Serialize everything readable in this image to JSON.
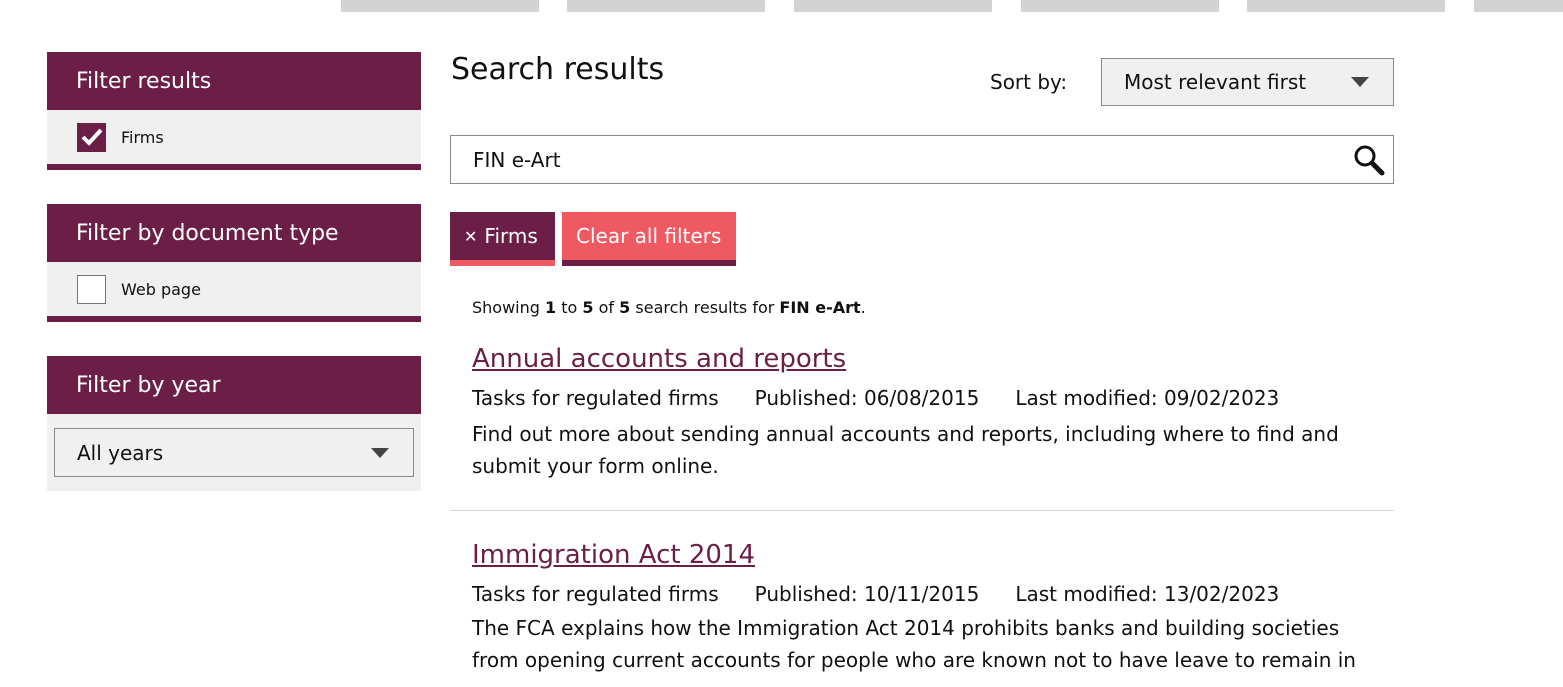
{
  "sidebar": {
    "filter_results": {
      "title": "Filter results",
      "option": {
        "label": "Firms",
        "checked": true
      }
    },
    "filter_doc_type": {
      "title": "Filter by document type",
      "option": {
        "label": "Web page",
        "checked": false
      }
    },
    "filter_year": {
      "title": "Filter by year",
      "selected": "All years"
    }
  },
  "main": {
    "title": "Search results",
    "sort": {
      "label": "Sort by:",
      "selected": "Most relevant first"
    },
    "search": {
      "value": "FIN e-Art"
    },
    "chips": {
      "firms_label": "Firms",
      "firms_remove_glyph": "✕",
      "clear_label": "Clear all filters"
    },
    "summary": {
      "prefix": "Showing",
      "from": "1",
      "to_word": "to",
      "to": "5",
      "of_word": "of",
      "total": "5",
      "suffix": "search results for",
      "query": "FIN e-Art",
      "end": "."
    },
    "results": [
      {
        "title": "Annual accounts and reports",
        "category": "Tasks for regulated firms",
        "published": "Published: 06/08/2015",
        "modified": "Last modified: 09/02/2023",
        "description": "Find out more about sending annual accounts and reports, including where to find and submit your form online."
      },
      {
        "title": "Immigration Act 2014",
        "category": "Tasks for regulated firms",
        "published": "Published: 10/11/2015",
        "modified": "Last modified: 13/02/2023",
        "description": "The FCA explains how the Immigration Act 2014 prohibits banks and building societies from opening current accounts for people who are known not to have leave to remain in"
      }
    ]
  },
  "colors": {
    "brand": "#6b1f46",
    "accent": "#ef5a62",
    "panel_bg": "#f0f0f0"
  },
  "icons": {
    "checkmark": "check-icon",
    "caret": "chevron-down-icon",
    "search": "search-icon",
    "remove": "close-icon"
  }
}
